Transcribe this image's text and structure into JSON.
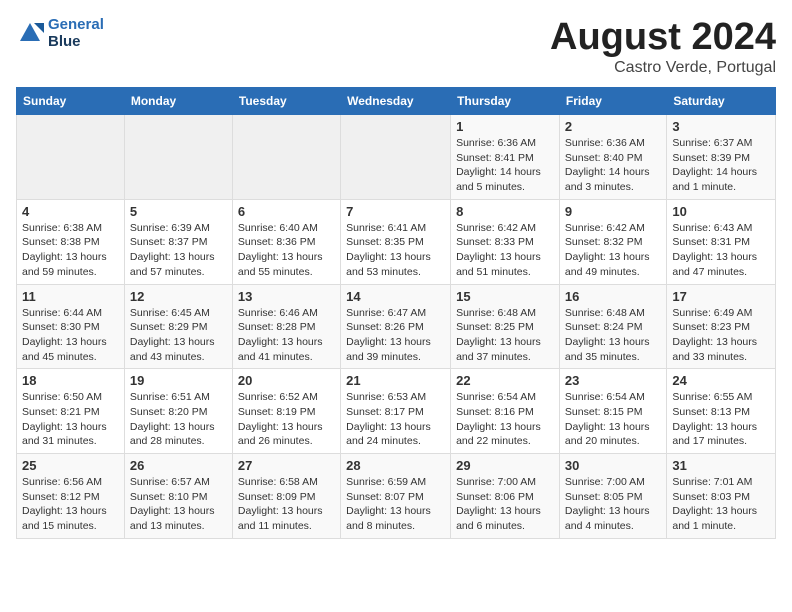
{
  "header": {
    "logo_line1": "General",
    "logo_line2": "Blue",
    "month": "August 2024",
    "location": "Castro Verde, Portugal"
  },
  "days_of_week": [
    "Sunday",
    "Monday",
    "Tuesday",
    "Wednesday",
    "Thursday",
    "Friday",
    "Saturday"
  ],
  "weeks": [
    [
      {
        "day": "",
        "content": ""
      },
      {
        "day": "",
        "content": ""
      },
      {
        "day": "",
        "content": ""
      },
      {
        "day": "",
        "content": ""
      },
      {
        "day": "1",
        "content": "Sunrise: 6:36 AM\nSunset: 8:41 PM\nDaylight: 14 hours\nand 5 minutes."
      },
      {
        "day": "2",
        "content": "Sunrise: 6:36 AM\nSunset: 8:40 PM\nDaylight: 14 hours\nand 3 minutes."
      },
      {
        "day": "3",
        "content": "Sunrise: 6:37 AM\nSunset: 8:39 PM\nDaylight: 14 hours\nand 1 minute."
      }
    ],
    [
      {
        "day": "4",
        "content": "Sunrise: 6:38 AM\nSunset: 8:38 PM\nDaylight: 13 hours\nand 59 minutes."
      },
      {
        "day": "5",
        "content": "Sunrise: 6:39 AM\nSunset: 8:37 PM\nDaylight: 13 hours\nand 57 minutes."
      },
      {
        "day": "6",
        "content": "Sunrise: 6:40 AM\nSunset: 8:36 PM\nDaylight: 13 hours\nand 55 minutes."
      },
      {
        "day": "7",
        "content": "Sunrise: 6:41 AM\nSunset: 8:35 PM\nDaylight: 13 hours\nand 53 minutes."
      },
      {
        "day": "8",
        "content": "Sunrise: 6:42 AM\nSunset: 8:33 PM\nDaylight: 13 hours\nand 51 minutes."
      },
      {
        "day": "9",
        "content": "Sunrise: 6:42 AM\nSunset: 8:32 PM\nDaylight: 13 hours\nand 49 minutes."
      },
      {
        "day": "10",
        "content": "Sunrise: 6:43 AM\nSunset: 8:31 PM\nDaylight: 13 hours\nand 47 minutes."
      }
    ],
    [
      {
        "day": "11",
        "content": "Sunrise: 6:44 AM\nSunset: 8:30 PM\nDaylight: 13 hours\nand 45 minutes."
      },
      {
        "day": "12",
        "content": "Sunrise: 6:45 AM\nSunset: 8:29 PM\nDaylight: 13 hours\nand 43 minutes."
      },
      {
        "day": "13",
        "content": "Sunrise: 6:46 AM\nSunset: 8:28 PM\nDaylight: 13 hours\nand 41 minutes."
      },
      {
        "day": "14",
        "content": "Sunrise: 6:47 AM\nSunset: 8:26 PM\nDaylight: 13 hours\nand 39 minutes."
      },
      {
        "day": "15",
        "content": "Sunrise: 6:48 AM\nSunset: 8:25 PM\nDaylight: 13 hours\nand 37 minutes."
      },
      {
        "day": "16",
        "content": "Sunrise: 6:48 AM\nSunset: 8:24 PM\nDaylight: 13 hours\nand 35 minutes."
      },
      {
        "day": "17",
        "content": "Sunrise: 6:49 AM\nSunset: 8:23 PM\nDaylight: 13 hours\nand 33 minutes."
      }
    ],
    [
      {
        "day": "18",
        "content": "Sunrise: 6:50 AM\nSunset: 8:21 PM\nDaylight: 13 hours\nand 31 minutes."
      },
      {
        "day": "19",
        "content": "Sunrise: 6:51 AM\nSunset: 8:20 PM\nDaylight: 13 hours\nand 28 minutes."
      },
      {
        "day": "20",
        "content": "Sunrise: 6:52 AM\nSunset: 8:19 PM\nDaylight: 13 hours\nand 26 minutes."
      },
      {
        "day": "21",
        "content": "Sunrise: 6:53 AM\nSunset: 8:17 PM\nDaylight: 13 hours\nand 24 minutes."
      },
      {
        "day": "22",
        "content": "Sunrise: 6:54 AM\nSunset: 8:16 PM\nDaylight: 13 hours\nand 22 minutes."
      },
      {
        "day": "23",
        "content": "Sunrise: 6:54 AM\nSunset: 8:15 PM\nDaylight: 13 hours\nand 20 minutes."
      },
      {
        "day": "24",
        "content": "Sunrise: 6:55 AM\nSunset: 8:13 PM\nDaylight: 13 hours\nand 17 minutes."
      }
    ],
    [
      {
        "day": "25",
        "content": "Sunrise: 6:56 AM\nSunset: 8:12 PM\nDaylight: 13 hours\nand 15 minutes."
      },
      {
        "day": "26",
        "content": "Sunrise: 6:57 AM\nSunset: 8:10 PM\nDaylight: 13 hours\nand 13 minutes."
      },
      {
        "day": "27",
        "content": "Sunrise: 6:58 AM\nSunset: 8:09 PM\nDaylight: 13 hours\nand 11 minutes."
      },
      {
        "day": "28",
        "content": "Sunrise: 6:59 AM\nSunset: 8:07 PM\nDaylight: 13 hours\nand 8 minutes."
      },
      {
        "day": "29",
        "content": "Sunrise: 7:00 AM\nSunset: 8:06 PM\nDaylight: 13 hours\nand 6 minutes."
      },
      {
        "day": "30",
        "content": "Sunrise: 7:00 AM\nSunset: 8:05 PM\nDaylight: 13 hours\nand 4 minutes."
      },
      {
        "day": "31",
        "content": "Sunrise: 7:01 AM\nSunset: 8:03 PM\nDaylight: 13 hours\nand 1 minute."
      }
    ]
  ]
}
